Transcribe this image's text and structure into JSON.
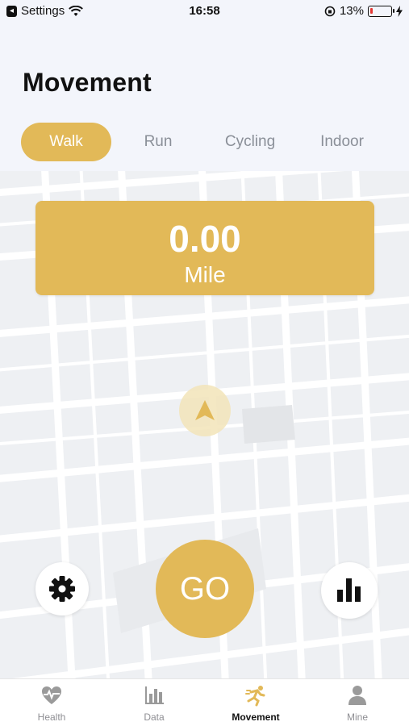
{
  "status_bar": {
    "back_app": "Settings",
    "time": "16:58",
    "battery_percent": "13%",
    "battery_level": 0.13
  },
  "page": {
    "title": "Movement"
  },
  "tabs": [
    {
      "label": "Walk",
      "active": true
    },
    {
      "label": "Run",
      "active": false
    },
    {
      "label": "Cycling",
      "active": false
    },
    {
      "label": "Indoor",
      "active": false
    }
  ],
  "distance": {
    "value": "0.00",
    "unit": "Mile"
  },
  "actions": {
    "go_label": "GO"
  },
  "bottom_nav": [
    {
      "label": "Health",
      "icon": "heart-pulse-icon",
      "active": false
    },
    {
      "label": "Data",
      "icon": "bar-chart-icon",
      "active": false
    },
    {
      "label": "Movement",
      "icon": "runner-icon",
      "active": true
    },
    {
      "label": "Mine",
      "icon": "person-icon",
      "active": false
    }
  ],
  "colors": {
    "accent": "#e2b958",
    "inactive_tab": "#8a8f98",
    "map_bg": "#eef0f3"
  }
}
